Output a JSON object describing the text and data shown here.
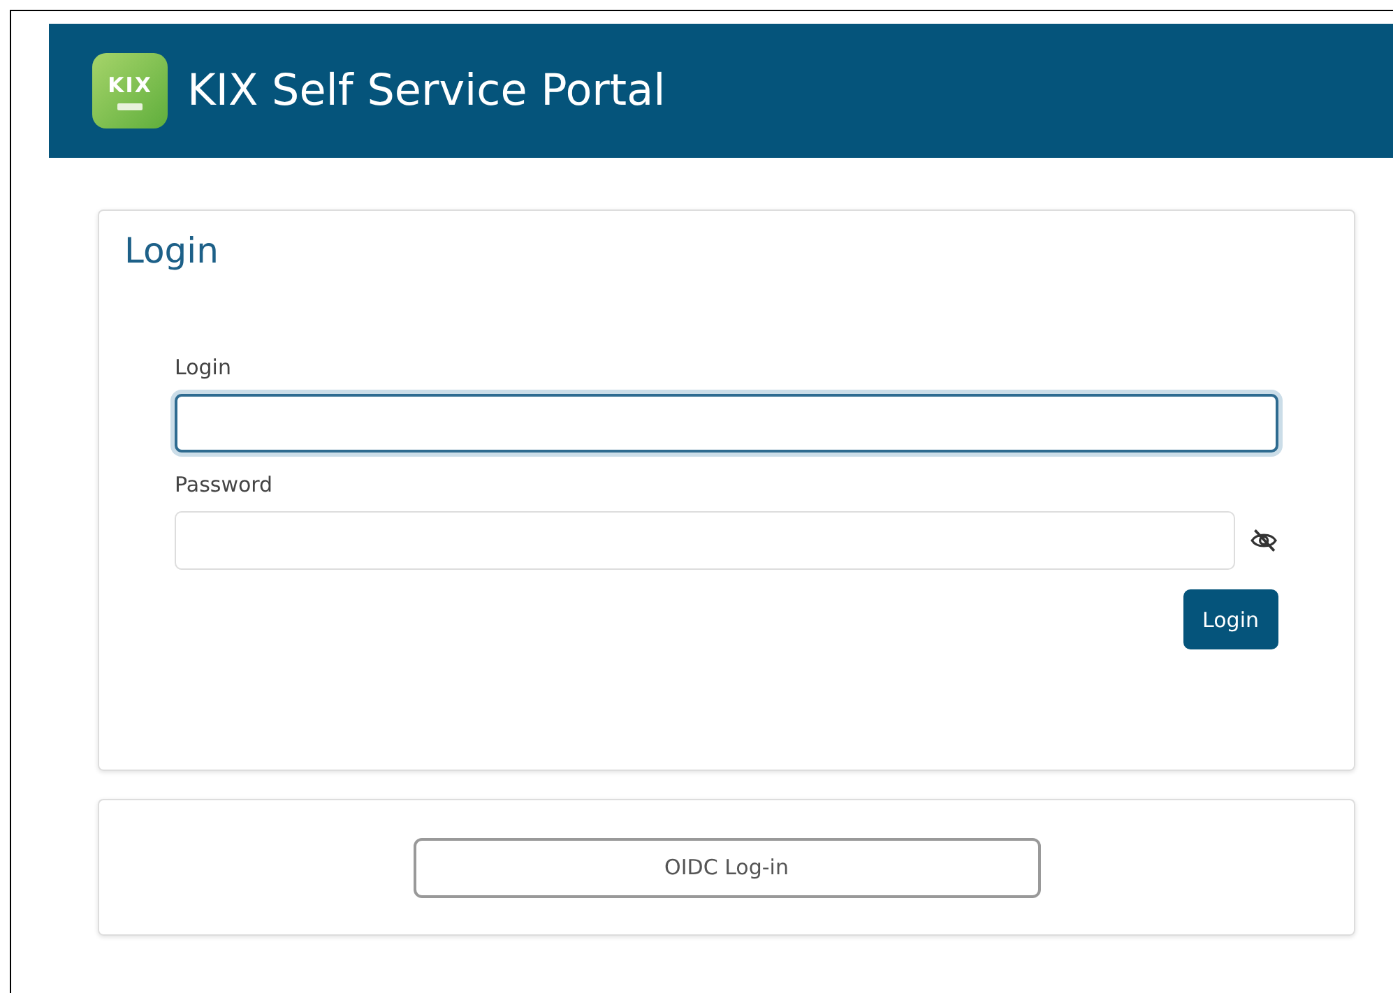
{
  "header": {
    "logo_text": "KIX",
    "title": "KIX Self Service Portal"
  },
  "login_card": {
    "title": "Login",
    "fields": [
      {
        "label": "Login",
        "kind": "text",
        "focused": true
      },
      {
        "label": "Password",
        "kind": "password",
        "focused": false
      }
    ],
    "submit": "Login"
  },
  "oidc_button": "OIDC Log-in"
}
